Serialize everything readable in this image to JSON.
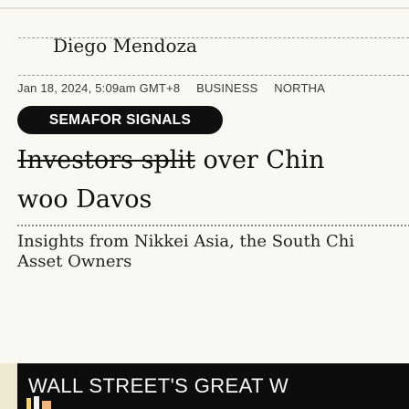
{
  "article": {
    "author": "Diego Mendoza",
    "dateline": {
      "date": "Jan 18, 2024, 5:09am GMT+8",
      "section": "BUSINESS",
      "region": "NORTHA"
    },
    "tag": "SEMAFOR SIGNALS",
    "headline": {
      "struck": "Investors split",
      "rest_line1": " over Chin",
      "line2": "woo Davos"
    },
    "subhead": {
      "line1": "Insights from Nikkei Asia, the South Chi",
      "line2": "Asset Owners"
    },
    "banner": {
      "text": "WALL STREET'S GREAT W"
    }
  }
}
